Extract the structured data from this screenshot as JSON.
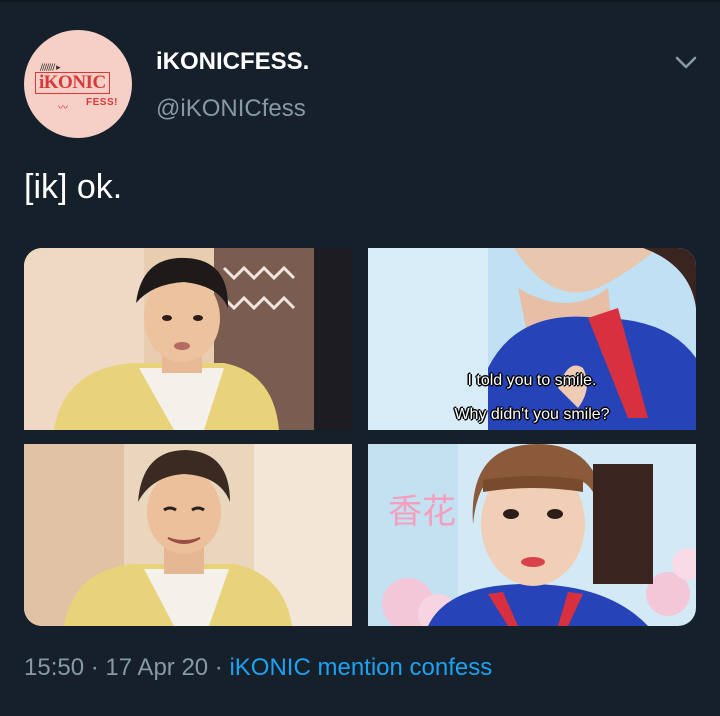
{
  "account": {
    "display_name": "iKONICFESS.",
    "handle": "@iKONICfess",
    "avatar": {
      "brand": "iKONIC",
      "sub": "FESS!",
      "bars": "/////// ▸"
    }
  },
  "tweet": {
    "text": "[ik] ok."
  },
  "media": {
    "captions": {
      "line1": "I told you to smile.",
      "line2": "Why didn't you smile?"
    },
    "sign_text": "香花"
  },
  "meta": {
    "time": "15:50",
    "separator": " · ",
    "date": "17 Apr 20",
    "source": "iKONIC mention confess"
  },
  "icons": {
    "more": "chevron-down-icon"
  },
  "colors": {
    "background": "#15202b",
    "secondary_text": "#8899a6",
    "link": "#1da1f2",
    "avatar_bg": "#f6cfc6",
    "brand_red": "#d9393a"
  }
}
